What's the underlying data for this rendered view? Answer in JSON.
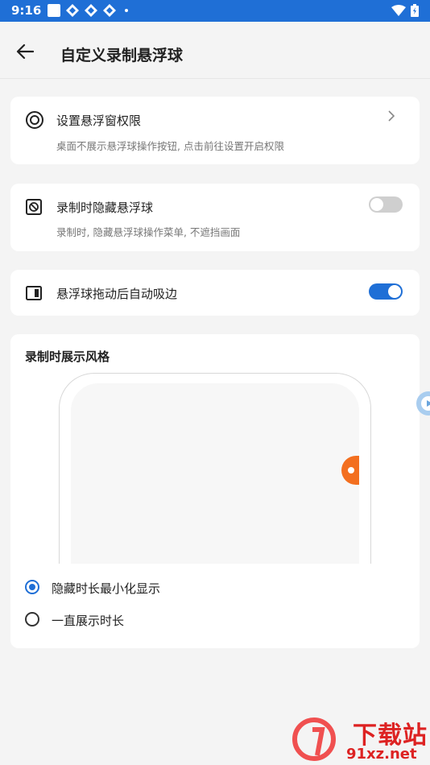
{
  "status_bar": {
    "time": "9:16"
  },
  "header": {
    "title": "自定义录制悬浮球"
  },
  "permission_card": {
    "title": "设置悬浮窗权限",
    "description": "桌面不展示悬浮球操作按钮, 点击前往设置开启权限"
  },
  "hide_card": {
    "title": "录制时隐藏悬浮球",
    "description": "录制时, 隐藏悬浮球操作菜单, 不遮挡画面",
    "toggle": "off"
  },
  "snap_card": {
    "title": "悬浮球拖动后自动吸边",
    "toggle": "on"
  },
  "style_card": {
    "title": "录制时展示风格",
    "options": [
      {
        "label": "隐藏时长最小化显示",
        "selected": true
      },
      {
        "label": "一直展示时长",
        "selected": false
      }
    ]
  },
  "watermark": {
    "line1": "下载站",
    "line2": "91xz.net"
  },
  "colors": {
    "accent": "#1f6fd6",
    "float_ball": "#f36f1f"
  }
}
